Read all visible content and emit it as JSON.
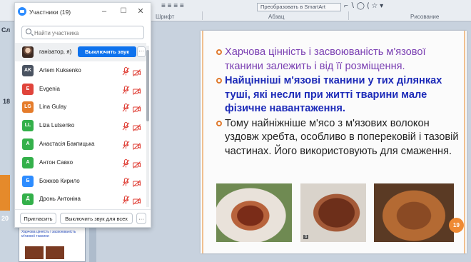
{
  "ribbon": {
    "font_group": "Шрифт",
    "paragraph_group": "Абзац",
    "drawing_group": "Рисование",
    "smartart_label": "Преобразовать в SmartArt",
    "section_label": "Сл"
  },
  "thumbnails": {
    "number_18": "18",
    "number_20": "20",
    "bottom_title": "Харчова цінність і засвоюваність м'язової тканини"
  },
  "slide": {
    "bullets": [
      "Харчова цінність і засвоюваність м'язової тканини залежить і від її розміщення.",
      "Найцінніші м'язові тканини у тих ділянках туші, які несли при житті тварини мале фізичне навантаження.",
      "Тому найніжніше м'ясо з м'язових волокон уздовж хребта, особливо в поперековій і тазовій частинах. Його використовують для смаження."
    ],
    "bullet_colors": [
      "#7a3fb2",
      "#1c2ab8",
      "#222222"
    ],
    "page_number": "19",
    "photo_caption": "6"
  },
  "participants": {
    "title": "Участники (19)",
    "search_placeholder": "Найти участника",
    "host": {
      "name": "ганізатор, я)",
      "mute_button": "Выключить звук",
      "more": "···"
    },
    "list": [
      {
        "initials": "AK",
        "name": "Artem Kuksenko",
        "color": "#4a5361"
      },
      {
        "initials": "E",
        "name": "Evgenia",
        "color": "#e0443b"
      },
      {
        "initials": "LG",
        "name": "Lina Gulay",
        "color": "#e57c2b"
      },
      {
        "initials": "LL",
        "name": "Liza Lutsenko",
        "color": "#33b04a"
      },
      {
        "initials": "A",
        "name": "Анастасія Бакпицька",
        "color": "#33b04a"
      },
      {
        "initials": "A",
        "name": "Антон Савко",
        "color": "#33b04a"
      },
      {
        "initials": "Б",
        "name": "Божков Кирило",
        "color": "#2d8cff"
      },
      {
        "initials": "Д",
        "name": "Дронь Антоніна",
        "color": "#33b04a"
      }
    ],
    "footer": {
      "invite": "Пригласить",
      "mute_all": "Выключить звук для всех",
      "more": "···"
    }
  }
}
